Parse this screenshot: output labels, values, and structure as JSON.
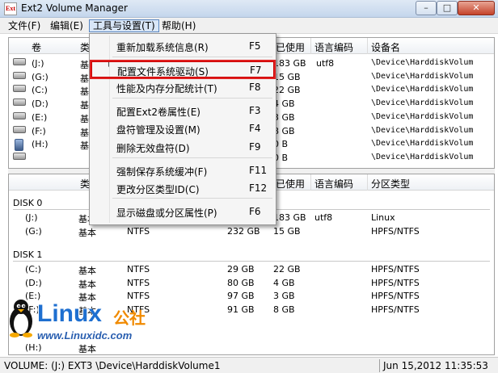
{
  "window": {
    "title": "Ext2 Volume Manager",
    "icon_text": "Ext"
  },
  "controls": {
    "minimize": "–",
    "maximize": "□",
    "close": "✕"
  },
  "menubar": [
    {
      "label": "文件(F)"
    },
    {
      "label": "编辑(E)"
    },
    {
      "label": "工具与设置(T)"
    },
    {
      "label": "帮助(H)"
    }
  ],
  "top_table": {
    "headers": [
      "卷",
      "类",
      "已使用",
      "语言编码",
      "设备名"
    ],
    "rows": [
      {
        "vol": "(J:)",
        "type": "基",
        "used": "183 GB",
        "codepage": "utf8",
        "device": "\\Device\\HarddiskVolum",
        "icon": "disk-icon"
      },
      {
        "vol": "(G:)",
        "type": "基",
        "used": "15 GB",
        "codepage": "",
        "device": "\\Device\\HarddiskVolum",
        "icon": "disk-icon"
      },
      {
        "vol": "(C:)",
        "type": "基",
        "used": "22 GB",
        "codepage": "",
        "device": "\\Device\\HarddiskVolum",
        "icon": "disk-icon"
      },
      {
        "vol": "(D:)",
        "type": "基",
        "used": "4 GB",
        "codepage": "",
        "device": "\\Device\\HarddiskVolum",
        "icon": "disk-icon"
      },
      {
        "vol": "(E:)",
        "type": "基",
        "used": "3 GB",
        "codepage": "",
        "device": "\\Device\\HarddiskVolum",
        "icon": "disk-icon"
      },
      {
        "vol": "(F:)",
        "type": "基",
        "used": "8 GB",
        "codepage": "",
        "device": "\\Device\\HarddiskVolum",
        "icon": "disk-icon"
      },
      {
        "vol": "(H:)",
        "type": "基",
        "used": "0 B",
        "codepage": "",
        "device": "\\Device\\HarddiskVolum",
        "icon": "usb-icon"
      },
      {
        "vol": "",
        "type": "",
        "used": "0 B",
        "codepage": "",
        "device": "\\Device\\HarddiskVolum",
        "icon": "disk-icon"
      }
    ]
  },
  "bottom_table": {
    "headers": [
      "类",
      "已使用",
      "语言编码",
      "分区类型"
    ],
    "disks": [
      {
        "label": "DISK 0",
        "rows": [
          {
            "vol": "(J:)",
            "type": "基本",
            "fs": "",
            "size": "",
            "used": "183 GB",
            "codepage": "utf8",
            "ptype": "Linux"
          },
          {
            "vol": "(G:)",
            "type": "基本",
            "fs": "NTFS",
            "size": "232 GB",
            "used": "15 GB",
            "codepage": "",
            "ptype": "HPFS/NTFS"
          }
        ]
      },
      {
        "label": "DISK 1",
        "rows": [
          {
            "vol": "(C:)",
            "type": "基本",
            "fs": "NTFS",
            "size": "29 GB",
            "used": "22 GB",
            "codepage": "",
            "ptype": "HPFS/NTFS"
          },
          {
            "vol": "(D:)",
            "type": "基本",
            "fs": "NTFS",
            "size": "80 GB",
            "used": "4 GB",
            "codepage": "",
            "ptype": "HPFS/NTFS"
          },
          {
            "vol": "(E:)",
            "type": "基本",
            "fs": "NTFS",
            "size": "97 GB",
            "used": "3 GB",
            "codepage": "",
            "ptype": "HPFS/NTFS"
          },
          {
            "vol": "(F:)",
            "type": "基本",
            "fs": "NTFS",
            "size": "91 GB",
            "used": "8 GB",
            "codepage": "",
            "ptype": "HPFS/NTFS"
          }
        ]
      }
    ],
    "tail_row": {
      "vol": "(H:)",
      "type": "基本"
    }
  },
  "dropdown": {
    "items": [
      {
        "label": "重新加载系统信息(R)",
        "key": "F5"
      },
      {
        "label": "配置文件系统驱动(S)",
        "key": "F7",
        "highlighted": true
      },
      {
        "label": "性能及内存分配统计(T)",
        "key": "F8"
      },
      {
        "label": "配置Ext2卷属性(E)",
        "key": "F3"
      },
      {
        "label": "盘符管理及设置(M)",
        "key": "F4"
      },
      {
        "label": "删除无效盘符(D)",
        "key": "F9"
      },
      {
        "label": "强制保存系统缓冲(F)",
        "key": "F11"
      },
      {
        "label": "更改分区类型ID(C)",
        "key": "F12"
      },
      {
        "label": "显示磁盘或分区属性(P)",
        "key": "F6"
      }
    ]
  },
  "statusbar": {
    "volume": "VOLUME: (J:) EXT3 \\Device\\HarddiskVolume1",
    "datetime": "Jun 15,2012 11:35:53"
  },
  "watermark": {
    "brand": "Linux",
    "brand_cn": "公社",
    "url": "www.Linuxidc.com"
  }
}
